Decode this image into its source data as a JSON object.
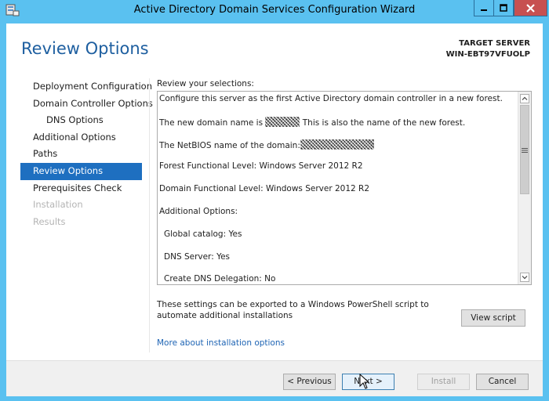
{
  "window": {
    "title": "Active Directory Domain Services Configuration Wizard"
  },
  "header": {
    "page_title": "Review Options",
    "target_server_label": "TARGET SERVER",
    "target_server_name": "WIN-EBT97VFUOLP"
  },
  "nav": {
    "items": [
      {
        "label": "Deployment Configuration",
        "state": "normal"
      },
      {
        "label": "Domain Controller Options",
        "state": "normal"
      },
      {
        "label": "DNS Options",
        "state": "sub"
      },
      {
        "label": "Additional Options",
        "state": "normal"
      },
      {
        "label": "Paths",
        "state": "normal"
      },
      {
        "label": "Review Options",
        "state": "active"
      },
      {
        "label": "Prerequisites Check",
        "state": "normal"
      },
      {
        "label": "Installation",
        "state": "disabled"
      },
      {
        "label": "Results",
        "state": "disabled"
      }
    ]
  },
  "review": {
    "label": "Review your selections:",
    "lines": {
      "l0": "Configure this server as the first Active Directory domain controller in a new forest.",
      "l1_pre": "The new domain name is",
      "l1_post": "This is also the name of the new forest.",
      "l2_pre": "The NetBIOS name of the domain:",
      "l3": "Forest Functional Level: Windows Server 2012 R2",
      "l4": "Domain Functional Level: Windows Server 2012 R2",
      "l5": "Additional Options:",
      "l6": "Global catalog: Yes",
      "l7": "DNS Server: Yes",
      "l8": "Create DNS Delegation: No"
    }
  },
  "export": {
    "text": "These settings can be exported to a Windows PowerShell script to automate additional installations",
    "view_script_label": "View script",
    "more_link": "More about installation options"
  },
  "footer": {
    "previous_label": "< Previous",
    "next_label": "Next >",
    "install_label": "Install",
    "cancel_label": "Cancel"
  },
  "colors": {
    "frame": "#5ac1f0",
    "accent": "#1e6fc0",
    "close": "#c75050",
    "link": "#1e64b4"
  },
  "icons": {
    "app": "server-manager-icon",
    "minimize": "minimize-icon",
    "maximize": "maximize-icon",
    "close": "close-icon",
    "scroll_up": "chevron-up-icon",
    "scroll_down": "chevron-down-icon",
    "cursor": "mouse-pointer-icon"
  }
}
